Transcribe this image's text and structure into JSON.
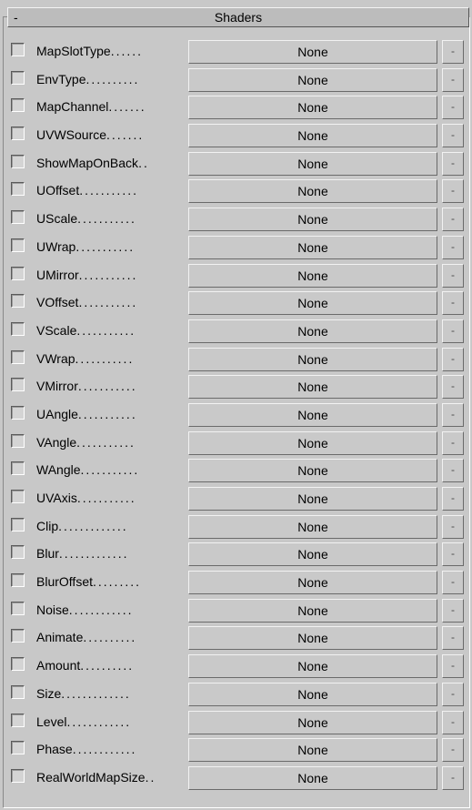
{
  "rollout": {
    "toggle": "-",
    "title": "Shaders"
  },
  "rows": [
    {
      "label": "MapSlotType",
      "leader": "......",
      "button": "None",
      "small_button": "-"
    },
    {
      "label": "EnvType",
      "leader": "..........",
      "button": "None",
      "small_button": "-"
    },
    {
      "label": "MapChannel",
      "leader": ".......",
      "button": "None",
      "small_button": "-"
    },
    {
      "label": "UVWSource",
      "leader": ".......",
      "button": "None",
      "small_button": "-"
    },
    {
      "label": "ShowMapOnBack",
      "leader": "..",
      "button": "None",
      "small_button": "-"
    },
    {
      "label": "UOffset",
      "leader": "...........",
      "button": "None",
      "small_button": "-"
    },
    {
      "label": "UScale",
      "leader": "...........",
      "button": "None",
      "small_button": "-"
    },
    {
      "label": "UWrap",
      "leader": "...........",
      "button": "None",
      "small_button": "-"
    },
    {
      "label": "UMirror",
      "leader": "...........",
      "button": "None",
      "small_button": "-"
    },
    {
      "label": "VOffset",
      "leader": "...........",
      "button": "None",
      "small_button": "-"
    },
    {
      "label": "VScale",
      "leader": "...........",
      "button": "None",
      "small_button": "-"
    },
    {
      "label": "VWrap",
      "leader": "...........",
      "button": "None",
      "small_button": "-"
    },
    {
      "label": "VMirror",
      "leader": "...........",
      "button": "None",
      "small_button": "-"
    },
    {
      "label": "UAngle",
      "leader": "...........",
      "button": "None",
      "small_button": "-"
    },
    {
      "label": "VAngle",
      "leader": "...........",
      "button": "None",
      "small_button": "-"
    },
    {
      "label": "WAngle",
      "leader": "...........",
      "button": "None",
      "small_button": "-"
    },
    {
      "label": "UVAxis",
      "leader": "...........",
      "button": "None",
      "small_button": "-"
    },
    {
      "label": "Clip",
      "leader": ".............",
      "button": "None",
      "small_button": "-"
    },
    {
      "label": "Blur",
      "leader": ".............",
      "button": "None",
      "small_button": "-"
    },
    {
      "label": "BlurOffset",
      "leader": ".........",
      "button": "None",
      "small_button": "-"
    },
    {
      "label": "Noise",
      "leader": "............",
      "button": "None",
      "small_button": "-"
    },
    {
      "label": "Animate",
      "leader": "..........",
      "button": "None",
      "small_button": "-"
    },
    {
      "label": "Amount",
      "leader": "..........",
      "button": "None",
      "small_button": "-"
    },
    {
      "label": "Size",
      "leader": ".............",
      "button": "None",
      "small_button": "-"
    },
    {
      "label": "Level",
      "leader": "............",
      "button": "None",
      "small_button": "-"
    },
    {
      "label": "Phase",
      "leader": "............",
      "button": "None",
      "small_button": "-"
    },
    {
      "label": "RealWorldMapSize",
      "leader": "..",
      "button": "None",
      "small_button": "-"
    }
  ]
}
